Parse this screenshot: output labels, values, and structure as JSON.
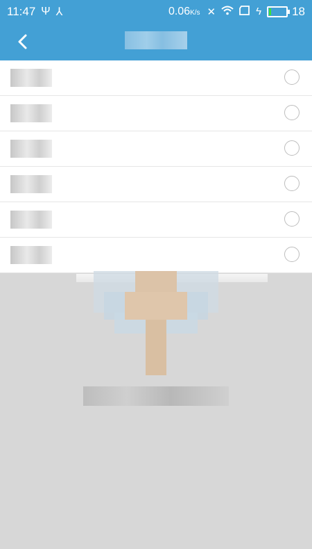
{
  "status_bar": {
    "time": "11:47",
    "network_speed": "0.06",
    "network_unit": "K/s",
    "battery_level": "18"
  },
  "nav": {
    "back_label": "<",
    "title": ""
  },
  "list": {
    "items": [
      {
        "label": "",
        "selected": false
      },
      {
        "label": "",
        "selected": false
      },
      {
        "label": "",
        "selected": false
      },
      {
        "label": "",
        "selected": false
      },
      {
        "label": "",
        "selected": false
      },
      {
        "label": "",
        "selected": false
      }
    ]
  },
  "overlay": {
    "hint_text": ""
  },
  "colors": {
    "accent": "#43a0d5",
    "overlay": "#d7d7d7",
    "battery_fill": "#3be03b"
  },
  "icons": {
    "usb": "usb-icon",
    "share": "share-icon",
    "mute": "mute-icon",
    "wifi": "wifi-icon",
    "sim": "sim-icon",
    "charge": "charging-icon",
    "battery": "battery-icon",
    "back": "chevron-left-icon",
    "hand": "pointer-hand-icon"
  }
}
